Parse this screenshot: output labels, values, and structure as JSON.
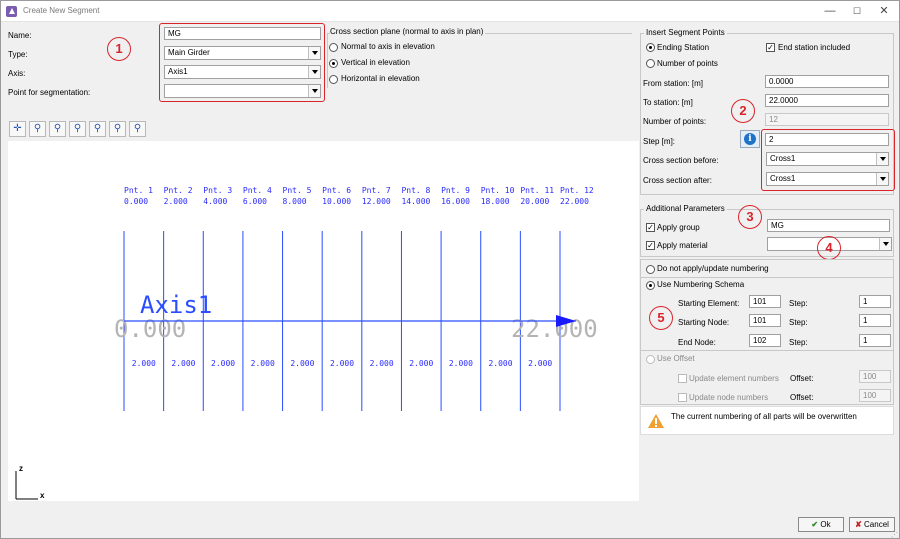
{
  "window": {
    "title": "Create New Segment",
    "minimize_glyph": "—",
    "maximize_glyph": "☐",
    "close_glyph": "✕"
  },
  "form": {
    "name_label": "Name:",
    "name_value": "MG",
    "type_label": "Type:",
    "type_value": "Main Girder",
    "axis_label": "Axis:",
    "axis_value": "Axis1",
    "point_label": "Point for segmentation:",
    "point_value": ""
  },
  "cross_section_plane": {
    "title": "Cross section plane (normal to axis in plan)",
    "options": [
      "Normal to axis in elevation",
      "Vertical in elevation",
      "Horizontal in elevation"
    ],
    "selected": "Vertical in elevation"
  },
  "insert": {
    "title": "Insert Segment Points",
    "ending_station": "Ending Station",
    "number_of_points_opt": "Number of points",
    "end_station_included": "End station included",
    "from_label": "From station: [m]",
    "from_value": "0.0000",
    "to_label": "To station: [m]",
    "to_value": "22.0000",
    "num_label": "Number of points:",
    "num_value": "12",
    "step_label": "Step [m]:",
    "step_value": "2",
    "cs_before_label": "Cross section before:",
    "cs_before_value": "Cross1",
    "cs_after_label": "Cross section after:",
    "cs_after_value": "Cross1"
  },
  "additional": {
    "title": "Additional Parameters",
    "apply_group": "Apply group",
    "group_value": "MG",
    "apply_material": "Apply material",
    "material_value": ""
  },
  "numbering": {
    "no_numbering": "Do not apply/update numbering",
    "use_schema": "Use Numbering Schema",
    "start_elem_label": "Starting Element:",
    "start_elem_value": "101",
    "start_node_label": "Starting Node:",
    "start_node_value": "101",
    "end_node_label": "End Node:",
    "end_node_value": "102",
    "step_label": "Step:",
    "step1": "1",
    "step2": "1",
    "step3": "1",
    "use_offset": "Use Offset",
    "update_elements": "Update element numbers",
    "offset_label": "Offset:",
    "offset1": "100",
    "update_nodes": "Update node numbers",
    "offset2": "100",
    "warning": "The current numbering of all parts will be overwritten"
  },
  "annotations": [
    "1",
    "2",
    "3",
    "4",
    "5"
  ],
  "chart_data": {
    "type": "diagram",
    "axis_name": "Axis1",
    "start_station": "0.000",
    "end_station": "22.000",
    "points": [
      "Pnt. 1",
      "Pnt. 2",
      "Pnt. 3",
      "Pnt. 4",
      "Pnt. 5",
      "Pnt. 6",
      "Pnt. 7",
      "Pnt. 8",
      "Pnt. 9",
      "Pnt. 10",
      "Pnt. 11",
      "Pnt. 12"
    ],
    "stations": [
      "0.000",
      "2.000",
      "4.000",
      "6.000",
      "8.000",
      "10.000",
      "12.000",
      "14.000",
      "16.000",
      "18.000",
      "20.000",
      "22.000"
    ],
    "station_values": [
      0,
      2,
      4,
      6,
      8,
      10,
      12,
      14,
      16,
      18,
      20,
      22
    ],
    "segment_lengths": [
      "2.000",
      "2.000",
      "2.000",
      "2.000",
      "2.000",
      "2.000",
      "2.000",
      "2.000",
      "2.000",
      "2.000",
      "2.000"
    ],
    "coord_x": "x",
    "coord_z": "z"
  },
  "colors": {
    "accent_red": "#d9242b",
    "line_blue": "#1a1aff",
    "ghost_gray": "#b4b4b4"
  },
  "buttons": {
    "ok": "Ok",
    "cancel": "Cancel"
  }
}
